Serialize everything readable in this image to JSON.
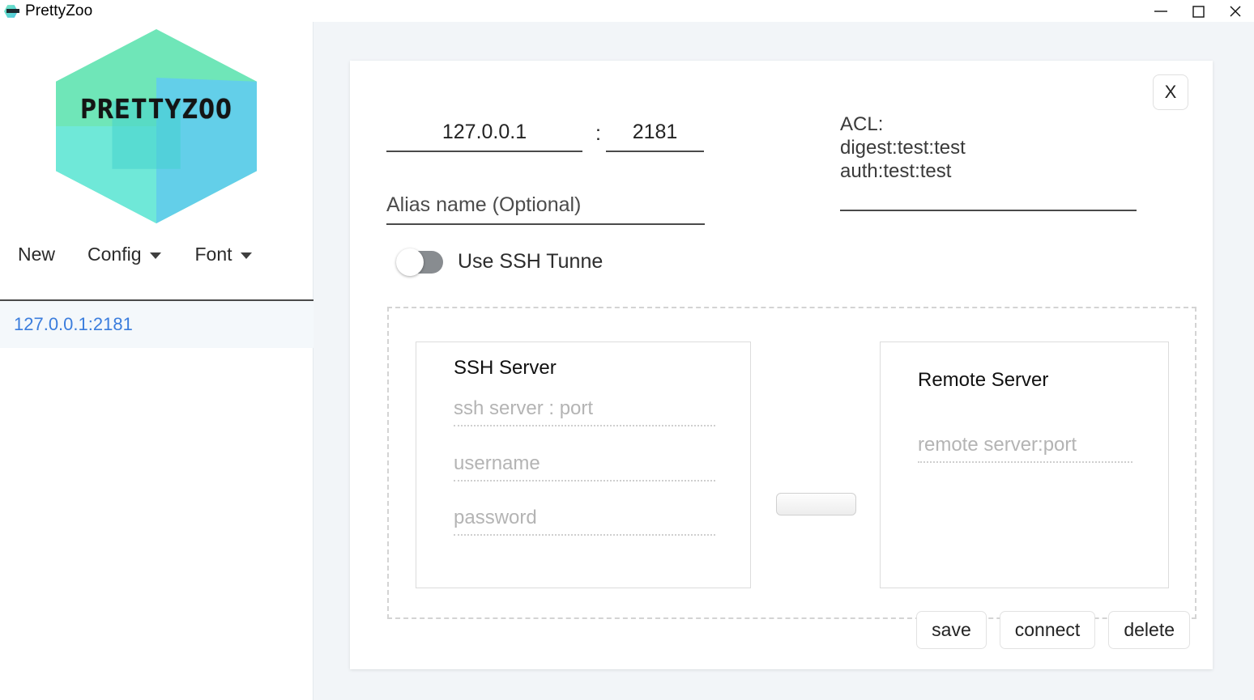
{
  "window": {
    "title": "PrettyZoo",
    "icon": "prettyzoo-hex-icon",
    "controls": {
      "minimize": "minimize-icon",
      "maximize": "maximize-icon",
      "close": "close-icon"
    }
  },
  "sidebar": {
    "logo_text": "PRETTYZOO",
    "menu": [
      {
        "label": "New",
        "has_caret": false
      },
      {
        "label": "Config",
        "has_caret": true
      },
      {
        "label": "Font",
        "has_caret": true
      }
    ],
    "connections": [
      {
        "label": "127.0.0.1:2181",
        "selected": true
      }
    ]
  },
  "form": {
    "close_button_label": "X",
    "host": {
      "value": "127.0.0.1",
      "placeholder": "host"
    },
    "separator": ":",
    "port": {
      "value": "2181",
      "placeholder": "port"
    },
    "alias": {
      "value": "",
      "placeholder": "Alias name (Optional)"
    },
    "acl": {
      "value": "",
      "placeholder": "ACL:\ndigest:test:test\nauth:test:test"
    },
    "ssh_tunnel": {
      "label": "Use SSH Tunne",
      "enabled": false
    },
    "ssh_server": {
      "title": "SSH Server",
      "server": {
        "value": "",
        "placeholder": "ssh server : port"
      },
      "username": {
        "value": "",
        "placeholder": "username"
      },
      "password": {
        "value": "",
        "placeholder": "password"
      }
    },
    "connector_button_label": "",
    "remote_server": {
      "title": "Remote Server",
      "server": {
        "value": "",
        "placeholder": "remote server:port"
      }
    },
    "actions": [
      {
        "label": "save"
      },
      {
        "label": "connect"
      },
      {
        "label": "delete"
      }
    ]
  },
  "colors": {
    "accent_blue": "#3b7ddd",
    "main_background": "#f2f5f8",
    "card_background": "#ffffff",
    "logo_green": "#6fe6b8",
    "logo_cyan": "#63cfe9",
    "logo_teal": "#6fe8d8"
  }
}
